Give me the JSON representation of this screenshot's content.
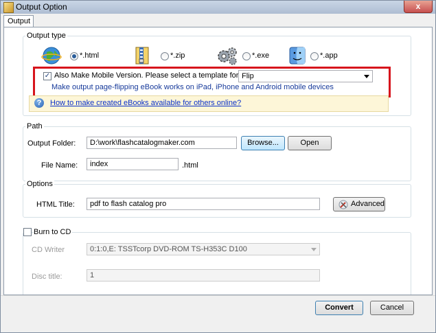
{
  "window": {
    "title": "Output Option",
    "close_glyph": "x"
  },
  "tab": {
    "label": "Output"
  },
  "output_type": {
    "label": "Output type",
    "options": [
      {
        "label": "*.html",
        "icon": "globe-icon",
        "selected": true
      },
      {
        "label": "*.zip",
        "icon": "zip-archive-icon",
        "selected": false
      },
      {
        "label": "*.exe",
        "icon": "gears-icon",
        "selected": false
      },
      {
        "label": "*.app",
        "icon": "mac-finder-icon",
        "selected": false
      }
    ],
    "mobile": {
      "checked": true,
      "label": "Also Make Mobile Version. Please select a template for mobile:",
      "template": "Flip",
      "description": "Make output page-flipping eBook works on iPad, iPhone and Android mobile devices"
    },
    "help_link": "How to make created eBooks available for others online?"
  },
  "path": {
    "label": "Path",
    "output_folder_label": "Output Folder:",
    "output_folder_value": "D:\\work\\flashcatalogmaker.com",
    "browse_label": "Browse...",
    "open_label": "Open",
    "file_name_label": "File Name:",
    "file_name_value": "index",
    "file_ext": ".html"
  },
  "options": {
    "label": "Options",
    "html_title_label": "HTML Title:",
    "html_title_value": "pdf to flash catalog pro",
    "advanced_label": "Advanced"
  },
  "burn": {
    "label": "Burn to CD",
    "checked": false,
    "cd_writer_label": "CD Writer",
    "cd_writer_value": "0:1:0,E: TSSTcorp DVD-ROM TS-H353C D100",
    "disc_title_label": "Disc title:",
    "disc_title_value": "1"
  },
  "footer": {
    "convert_label": "Convert",
    "cancel_label": "Cancel"
  },
  "colors": {
    "highlight_border": "#d7141c",
    "link": "#0a31c9",
    "help_bar": "#fdf6d8"
  }
}
